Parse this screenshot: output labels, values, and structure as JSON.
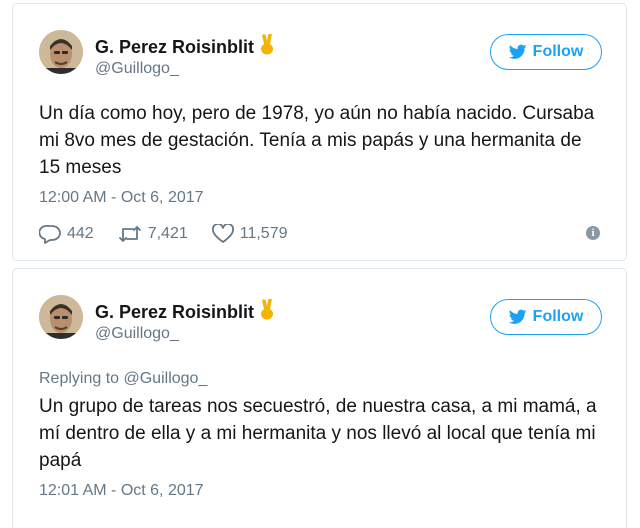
{
  "tweets": [
    {
      "author": "G. Perez Roisinblit",
      "handle": "@Guillogo_",
      "follow_label": "Follow",
      "text": "Un día como hoy, pero de 1978, yo aún no había nacido. Cursaba mi 8vo mes de gestación. Tenía a mis papás y una hermanita de 15 meses",
      "timestamp": "12:00 AM - Oct 6, 2017",
      "replies": "442",
      "retweets": "7,421",
      "likes": "11,579",
      "info_icon": "i"
    },
    {
      "author": "G. Perez Roisinblit",
      "handle": "@Guillogo_",
      "follow_label": "Follow",
      "replying_to": "Replying to @Guillogo_",
      "text": "Un grupo de tareas nos secuestró, de nuestra casa, a mi mamá, a mí dentro de ella y a mi hermanita y nos llevó al local que tenía mi papá",
      "timestamp": "12:01 AM - Oct 6, 2017"
    }
  ],
  "icons": {
    "hand": "victory-hand-icon",
    "bird": "twitter-bird-icon",
    "reply": "reply-icon",
    "retweet": "retweet-icon",
    "like": "heart-icon",
    "info": "info-icon"
  },
  "colors": {
    "accent": "#1da1f2",
    "muted": "#657786",
    "text": "#14171a",
    "border": "#e1e8ed"
  }
}
